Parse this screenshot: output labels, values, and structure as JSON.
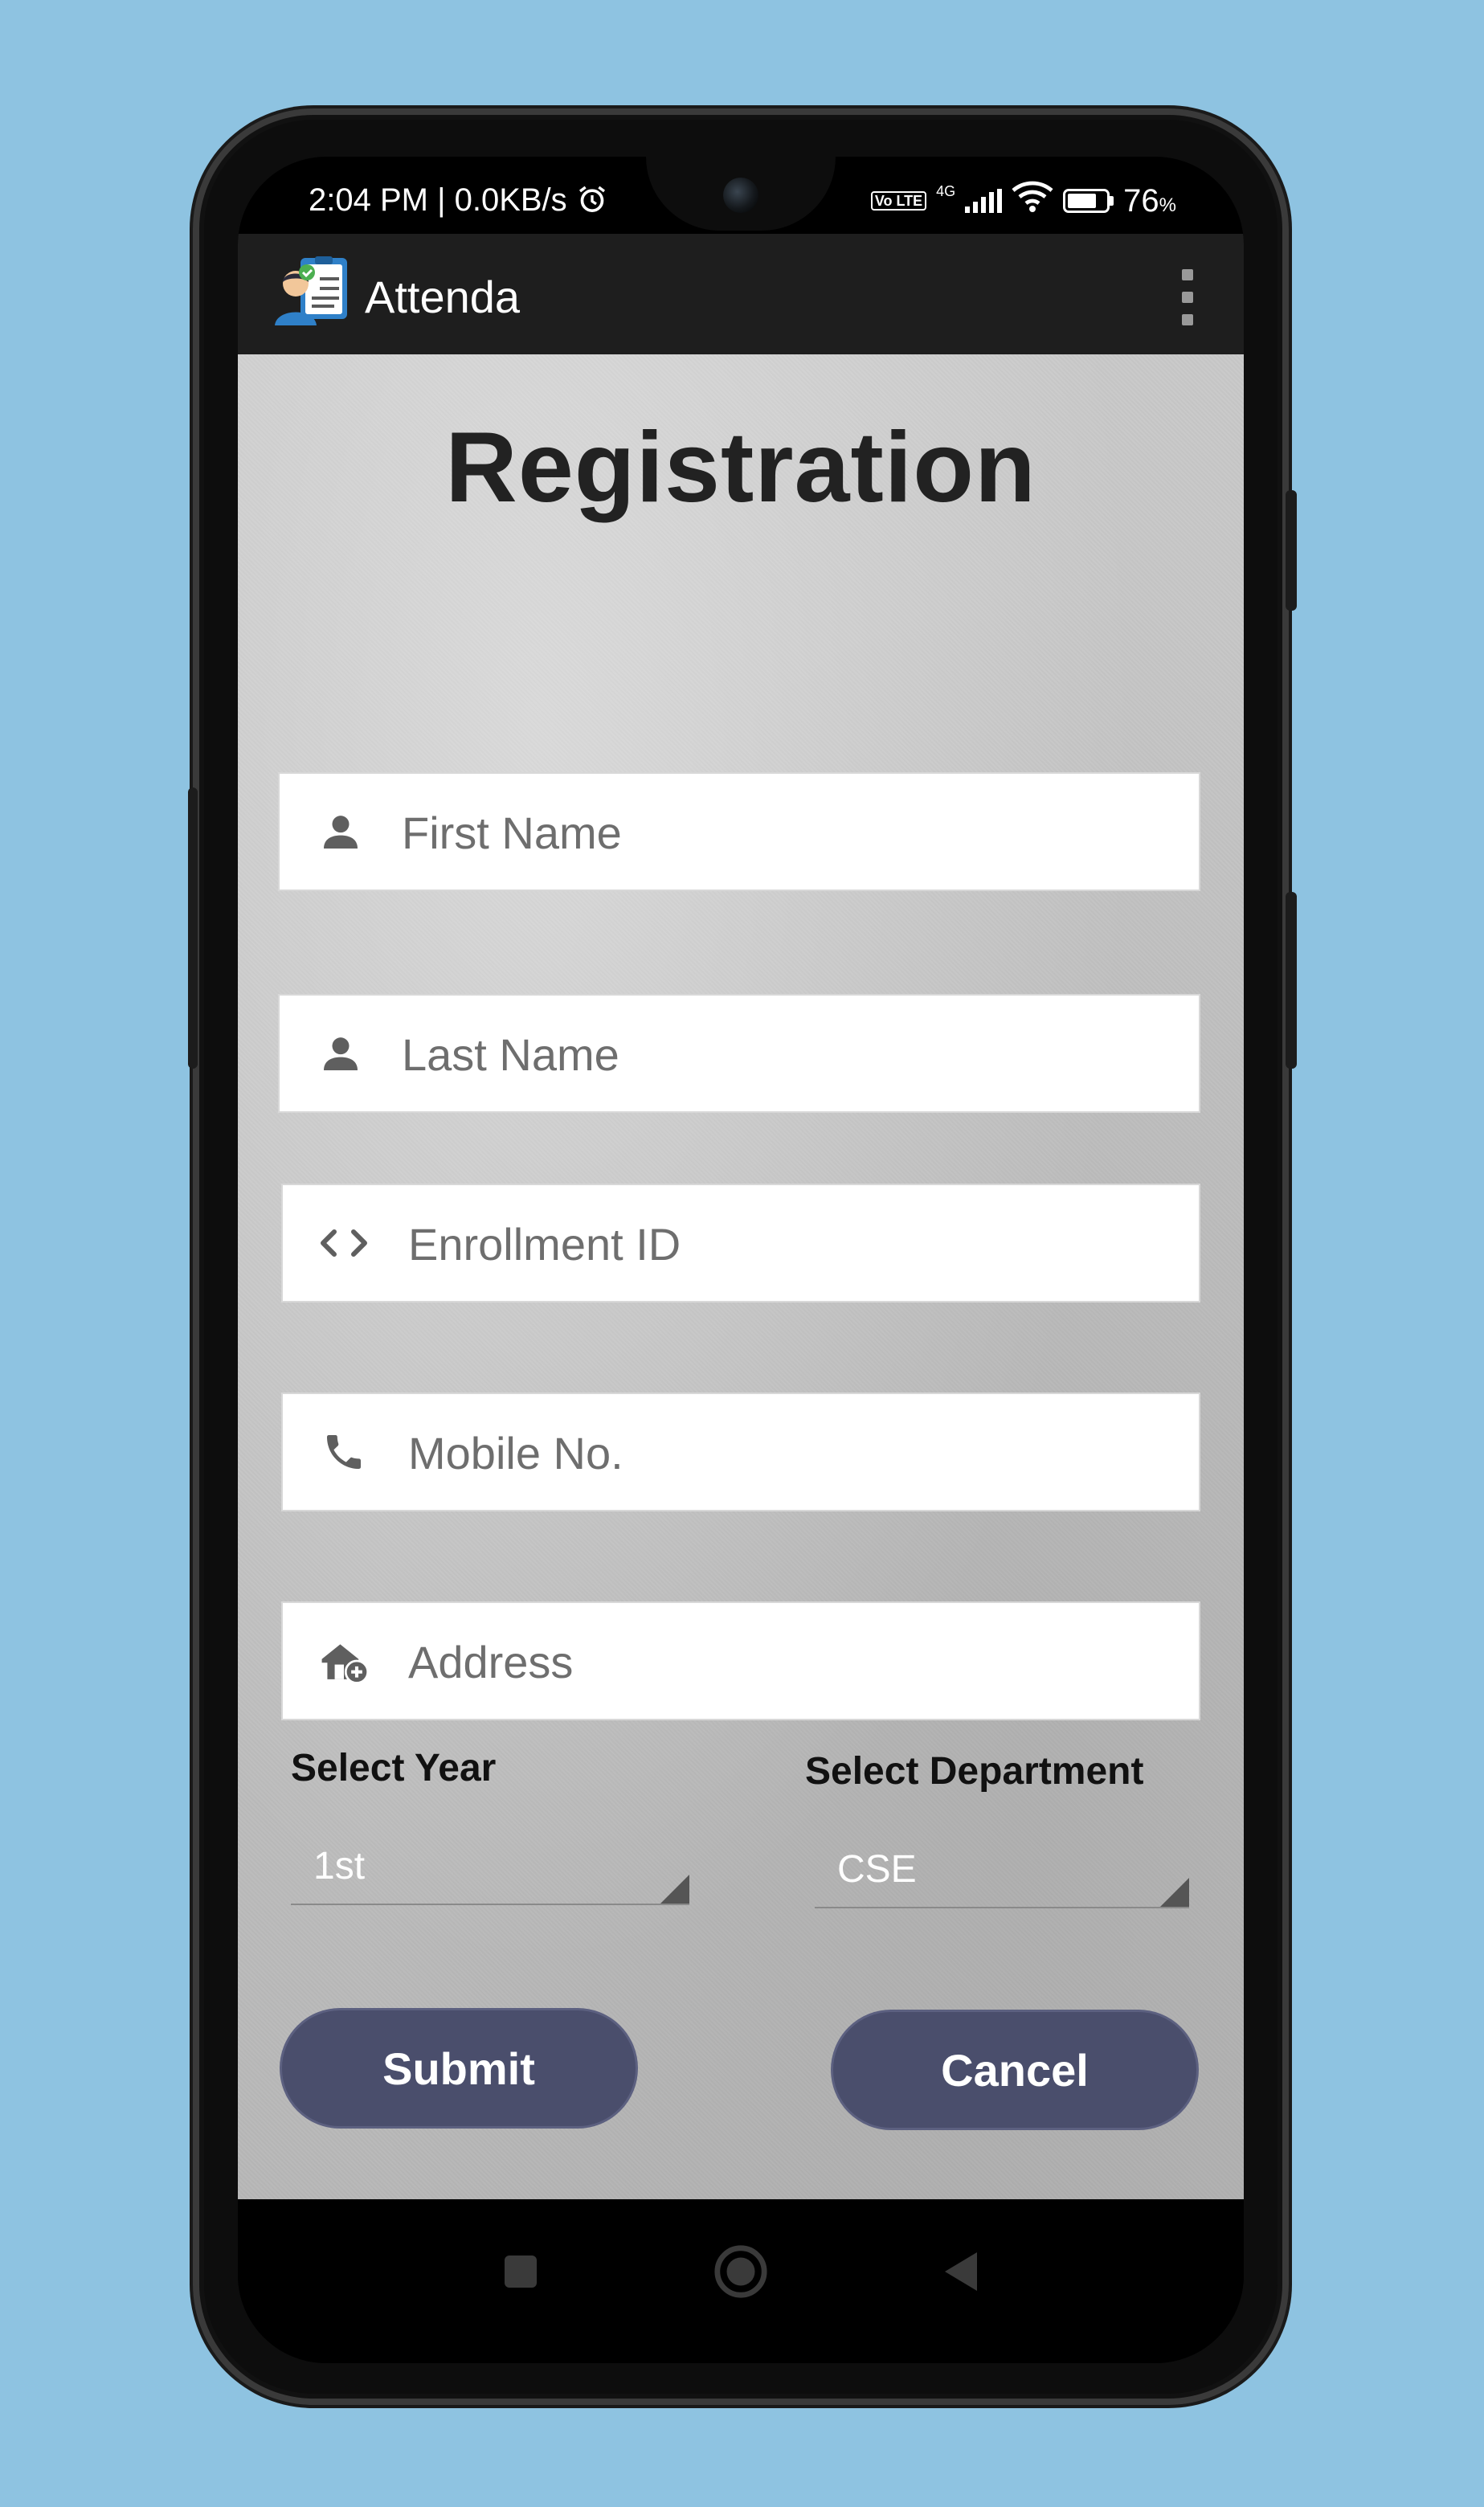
{
  "status_bar": {
    "time_speed": "2:04 PM | 0.0KB/s",
    "volte": "Vo LTE",
    "network": "4G",
    "battery_text": "76",
    "battery_unit": "%",
    "battery_level": 0.76
  },
  "app_bar": {
    "title": "Attenda",
    "logo_icon": "attendance-clipboard-icon",
    "menu_icon": "more-vert-icon"
  },
  "form": {
    "title": "Registration",
    "fields": [
      {
        "placeholder": "First Name",
        "icon": "person-icon"
      },
      {
        "placeholder": "Last Name",
        "icon": "person-icon"
      },
      {
        "placeholder": "Enrollment ID",
        "icon": "code-icon"
      },
      {
        "placeholder": "Mobile No.",
        "icon": "phone-icon"
      },
      {
        "placeholder": "Address",
        "icon": "add-home-icon"
      }
    ],
    "year": {
      "label": "Select Year",
      "value": "1st"
    },
    "department": {
      "label": "Select Department",
      "value": "CSE"
    },
    "submit_label": "Submit",
    "cancel_label": "Cancel"
  },
  "nav_bar": {
    "recents_icon": "square-icon",
    "home_icon": "circle-icon",
    "back_icon": "triangle-back-icon"
  },
  "colors": {
    "background": "#8ec3e1",
    "button": "#4a4e6c",
    "app_bar": "#1e1e1e"
  }
}
